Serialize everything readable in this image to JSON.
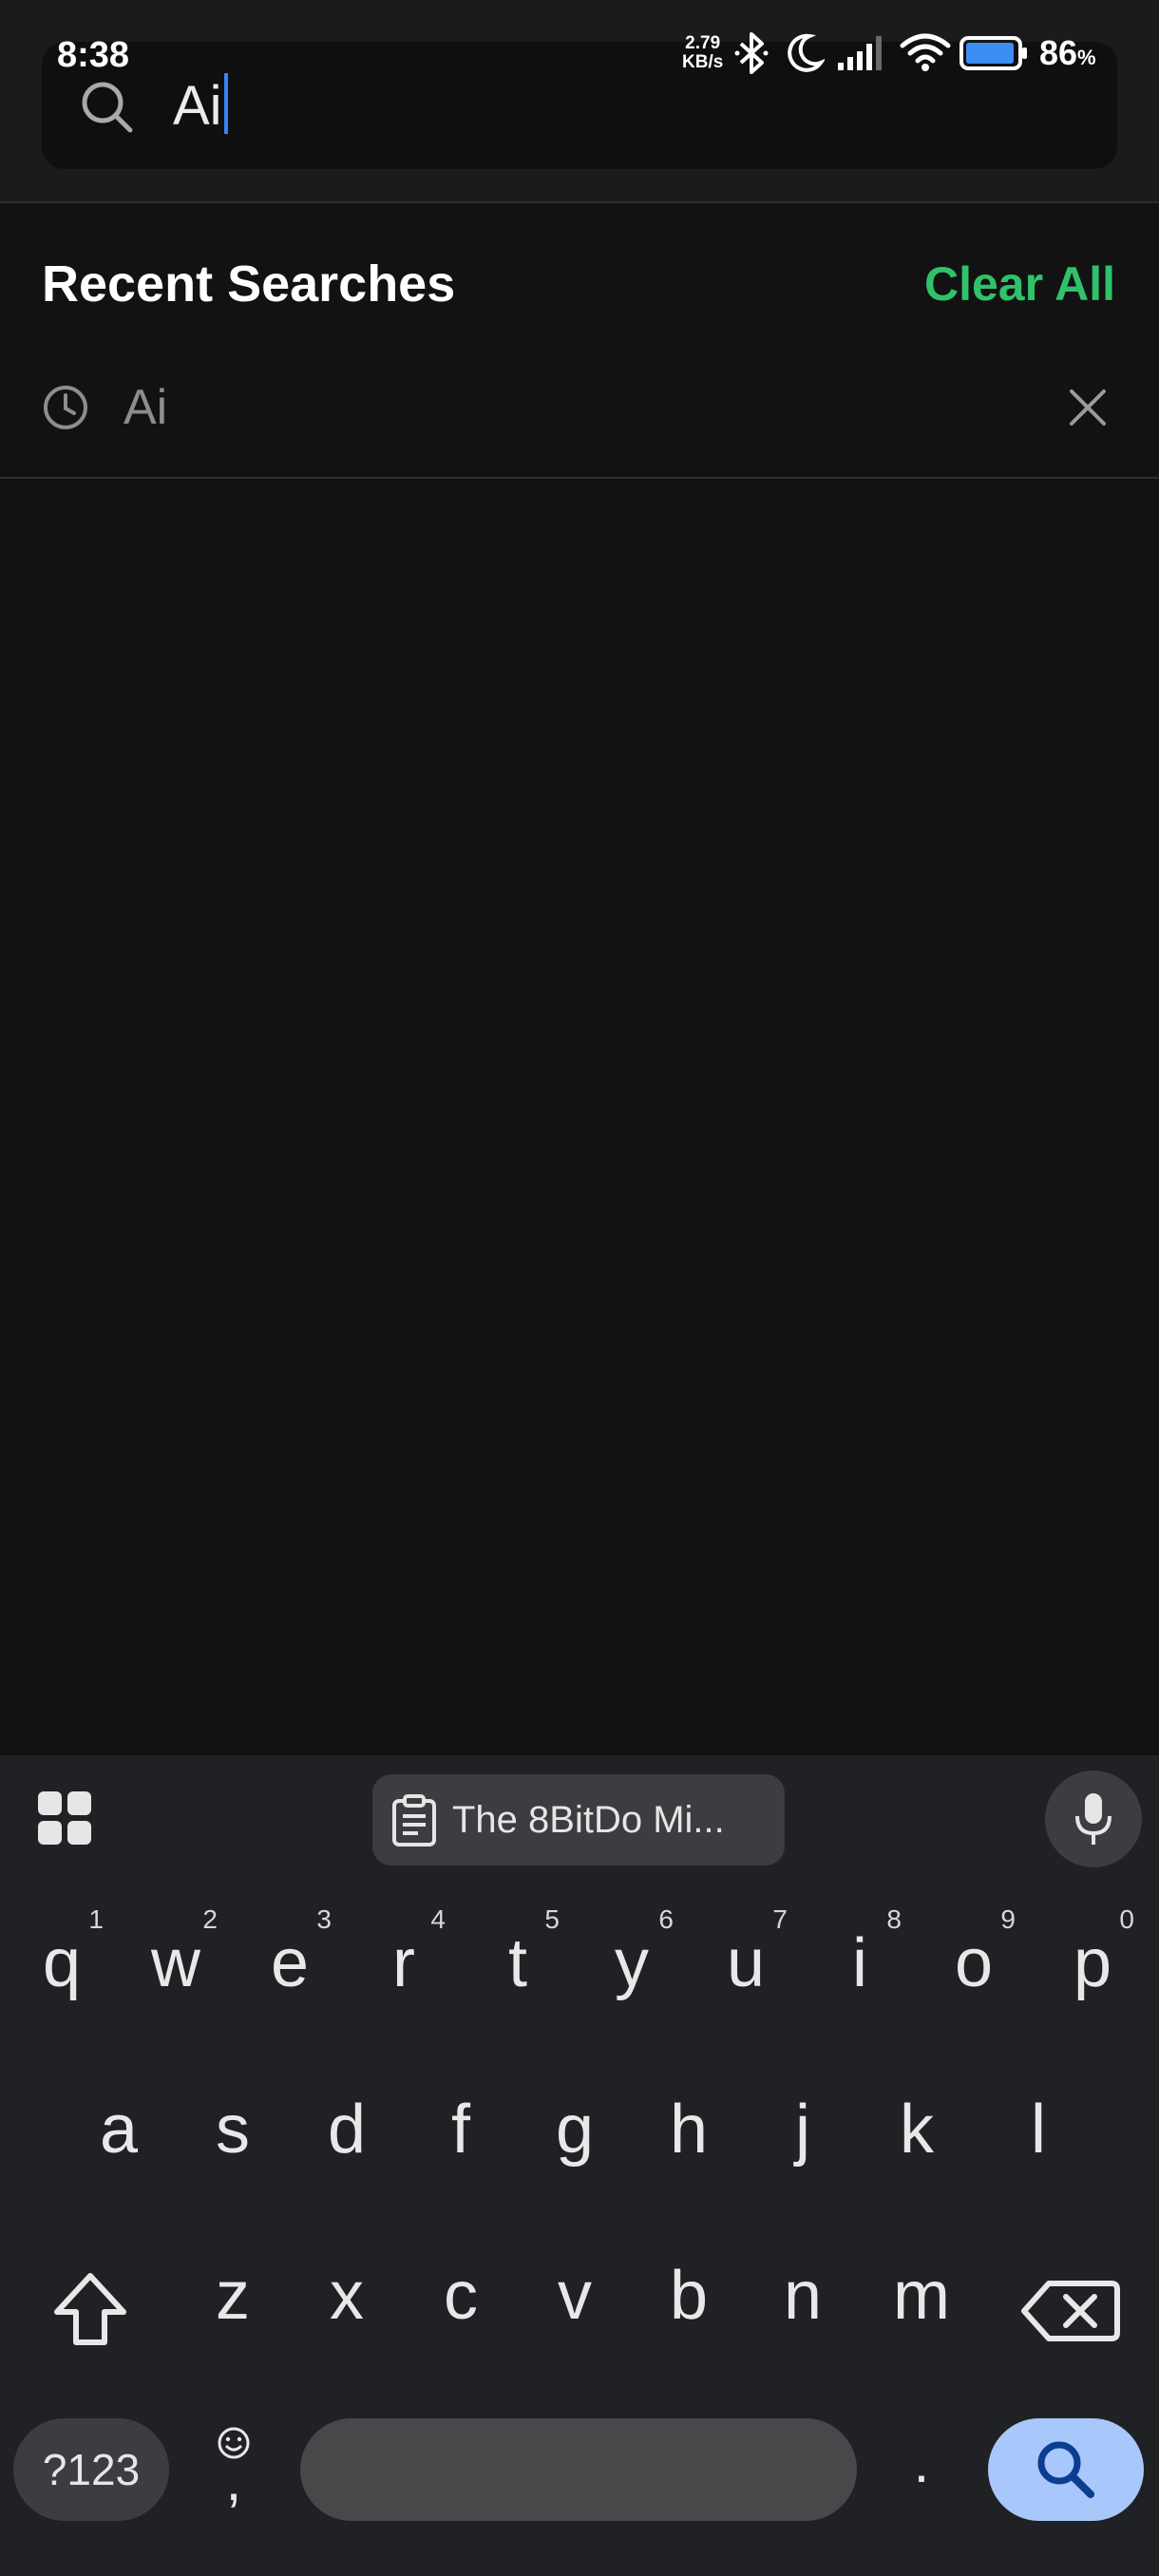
{
  "status_bar": {
    "time": "8:38",
    "net_speed_value": "2.79",
    "net_speed_unit": "KB/s",
    "battery_percent": "86",
    "battery_percent_sign": "%"
  },
  "search": {
    "query": "Ai"
  },
  "recent": {
    "title": "Recent Searches",
    "clear_all": "Clear All",
    "items": [
      {
        "label": "Ai"
      }
    ]
  },
  "keyboard": {
    "clipboard_chip": "The 8BitDo Mi...",
    "row1": [
      {
        "ch": "q",
        "hint": "1"
      },
      {
        "ch": "w",
        "hint": "2"
      },
      {
        "ch": "e",
        "hint": "3"
      },
      {
        "ch": "r",
        "hint": "4"
      },
      {
        "ch": "t",
        "hint": "5"
      },
      {
        "ch": "y",
        "hint": "6"
      },
      {
        "ch": "u",
        "hint": "7"
      },
      {
        "ch": "i",
        "hint": "8"
      },
      {
        "ch": "o",
        "hint": "9"
      },
      {
        "ch": "p",
        "hint": "0"
      }
    ],
    "row2": [
      "a",
      "s",
      "d",
      "f",
      "g",
      "h",
      "j",
      "k",
      "l"
    ],
    "row3": [
      "z",
      "x",
      "c",
      "v",
      "b",
      "n",
      "m"
    ],
    "symbols_label": "?123",
    "comma": ",",
    "period": "."
  },
  "colors": {
    "accent_green": "#2fc26b",
    "caret_blue": "#3b82f6",
    "search_key_bg": "#a8c7fa"
  },
  "icons": [
    "search-icon",
    "bluetooth-icon",
    "moon-icon",
    "signal-icon",
    "wifi-icon",
    "battery-icon",
    "clock-icon",
    "close-icon",
    "apps-grid-icon",
    "clipboard-icon",
    "microphone-icon",
    "shift-icon",
    "backspace-icon",
    "emoji-icon",
    "search-key-icon"
  ]
}
